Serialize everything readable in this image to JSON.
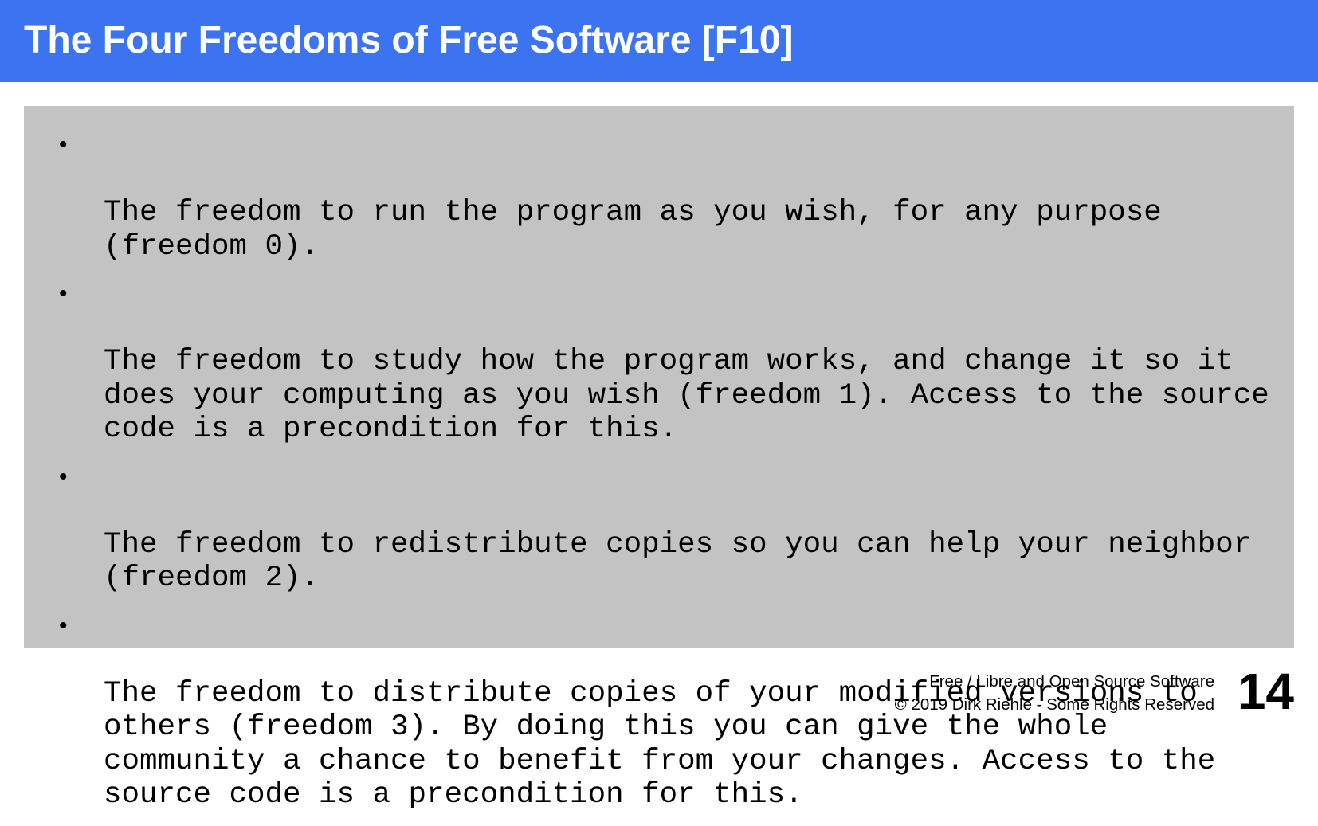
{
  "slide": {
    "title": "The Four Freedoms of Free Software [F10]",
    "bullets": [
      {
        "marker": "•",
        "text": "The freedom to run the program as you wish, for any purpose\n(freedom 0)."
      },
      {
        "marker": "•",
        "text": "The freedom to study how the program works, and change it so it\ndoes your computing as you wish (freedom 1). Access to the source\ncode is a precondition for this."
      },
      {
        "marker": "•",
        "text": "The freedom to redistribute copies so you can help your neighbor\n(freedom 2)."
      },
      {
        "marker": "•",
        "text": "The freedom to distribute copies of your modified versions to\nothers (freedom 3). By doing this you can give the whole\ncommunity a chance to benefit from your changes. Access to the\nsource code is a precondition for this."
      }
    ]
  },
  "footer": {
    "course": "Free / Libre and Open Source Software",
    "copyright": "© 2019 Dirk Riehle - Some Rights Reserved",
    "page_number": "14"
  },
  "colors": {
    "title_bar": "#3c73f0",
    "content_background": "#c3c3c3",
    "title_text": "#ffffff",
    "body_text": "#000000"
  }
}
